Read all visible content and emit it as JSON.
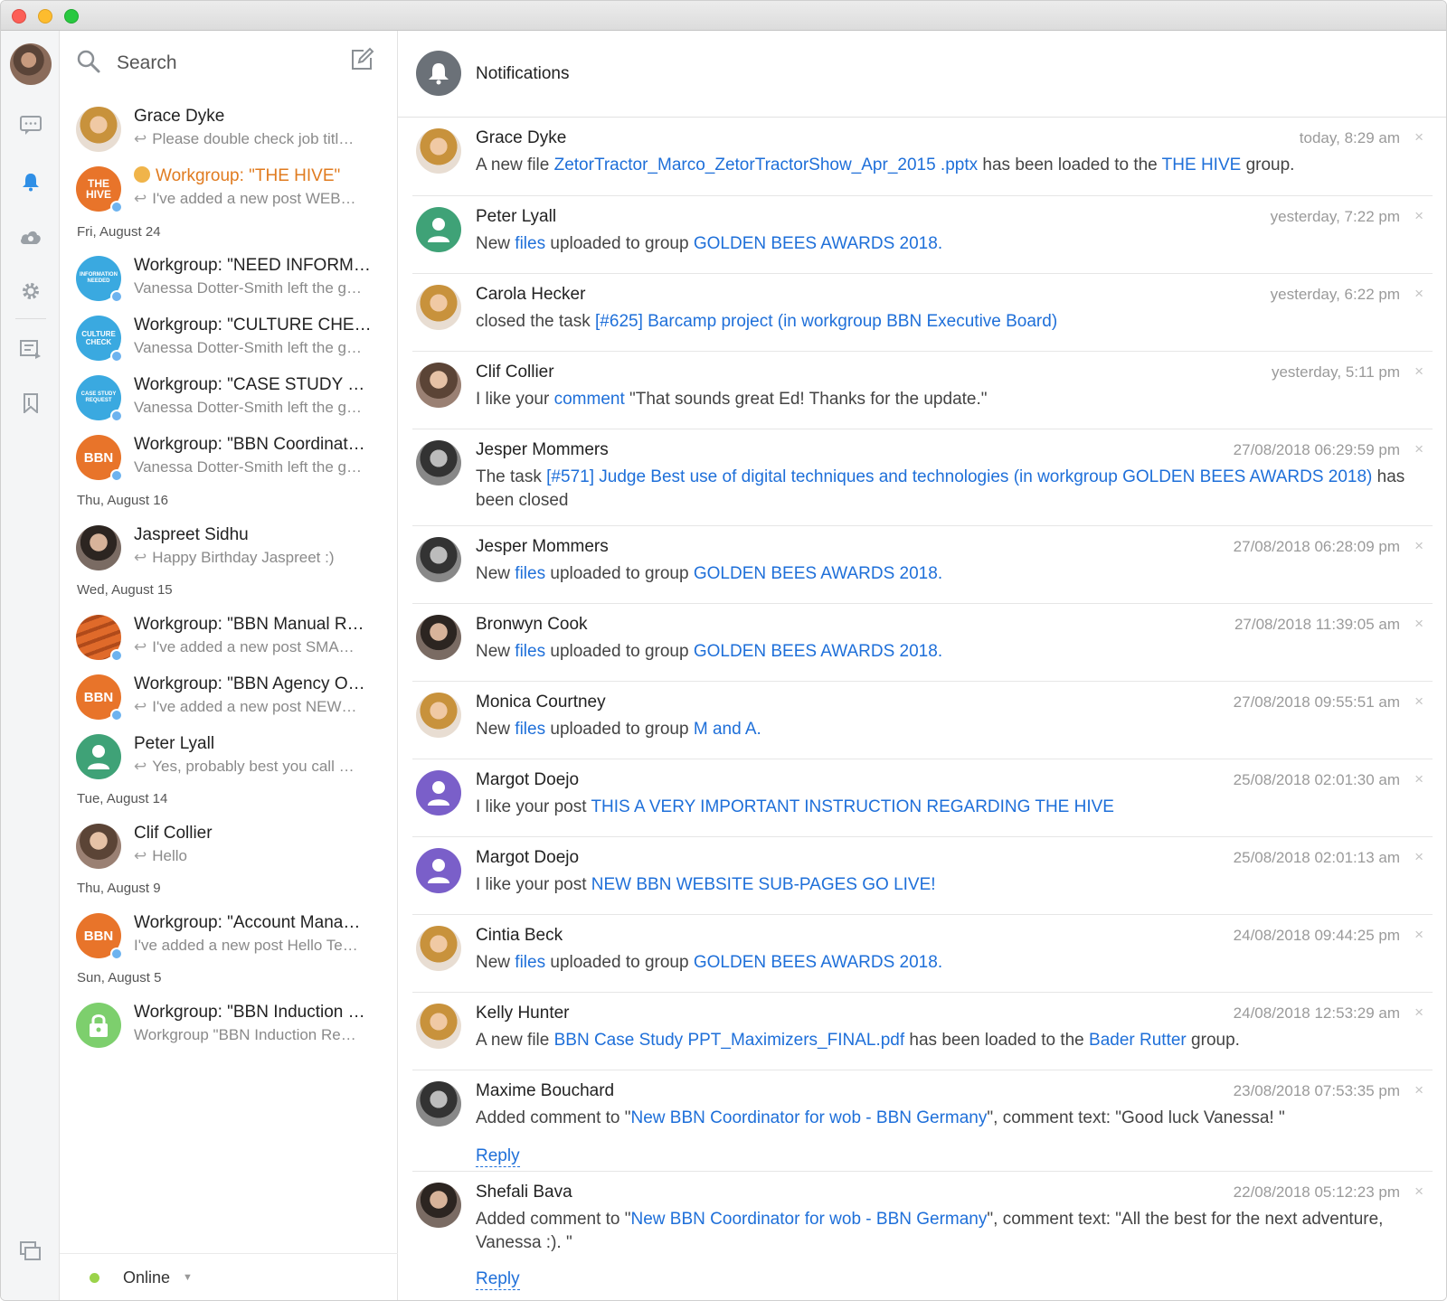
{
  "search": {
    "label": "Search"
  },
  "notifications_header": {
    "title": "Notifications"
  },
  "chats": [
    {
      "name": "Grace Dyke",
      "preview": "Please double check job titl…",
      "reply": true
    },
    {
      "name": "Workgroup: \"THE HIVE\"",
      "preview": "I've added a new post WEB…",
      "reply": true,
      "badge": "THE HIVE",
      "color": "#e8742a"
    },
    {
      "name": "Workgroup: \"NEED INFORM…",
      "preview": "Vanessa Dotter-Smith left the g…",
      "badge": "INFORMATION NEEDED",
      "color": "#3aa9e0"
    },
    {
      "name": "Workgroup: \"CULTURE CHE…",
      "preview": "Vanessa Dotter-Smith left the g…",
      "badge": "CULTURE CHECK",
      "color": "#3aa9e0"
    },
    {
      "name": "Workgroup: \"CASE STUDY …",
      "preview": "Vanessa Dotter-Smith left the g…",
      "badge": "CASE STUDY REQUEST",
      "color": "#3aa9e0"
    },
    {
      "name": "Workgroup: \"BBN Coordinat…",
      "preview": "Vanessa Dotter-Smith left the g…",
      "badge": "BBN",
      "color": "#e8742a"
    },
    {
      "name": "Jaspreet Sidhu",
      "preview": "Happy Birthday Jaspreet :)",
      "reply": true
    },
    {
      "name": "Workgroup: \"BBN Manual R…",
      "preview": "I've added a new post SMA…",
      "reply": true,
      "color": "#e8742a"
    },
    {
      "name": "Workgroup: \"BBN Agency O…",
      "preview": "I've added a new post NEW…",
      "reply": true,
      "badge": "BBN",
      "color": "#e8742a"
    },
    {
      "name": "Peter Lyall",
      "preview": "Yes, probably best you call …",
      "reply": true
    },
    {
      "name": "Clif Collier",
      "preview": "Hello",
      "reply": true
    },
    {
      "name": "Workgroup: \"Account Mana…",
      "preview": "I've added a new post Hello Te…",
      "badge": "BBN",
      "color": "#e8742a"
    },
    {
      "name": "Workgroup: \"BBN Induction …",
      "preview": "Workgroup \"BBN Induction Re…",
      "color": "#7dcf6d"
    }
  ],
  "date_headers": [
    "Fri, August 24",
    "Thu, August 16",
    "Wed, August 15",
    "Tue, August 14",
    "Thu, August 9",
    "Sun, August 5"
  ],
  "status": {
    "label": "Online"
  },
  "notifications": [
    {
      "who": "Grace Dyke",
      "time": "today, 8:29 am",
      "parts": [
        "A new file ",
        "ZetorTractor_Marco_ZetorTractorShow_Apr_2015 .pptx",
        " has been loaded to the ",
        "THE HIVE",
        " group."
      ]
    },
    {
      "who": "Peter Lyall",
      "time": "yesterday, 7:22 pm",
      "parts": [
        "New ",
        "files",
        " uploaded to group ",
        "GOLDEN BEES AWARDS 2018.",
        ""
      ]
    },
    {
      "who": "Carola Hecker",
      "time": "yesterday, 6:22 pm",
      "parts": [
        "closed the task ",
        "[#625] Barcamp project (in workgroup BBN Executive Board)",
        "",
        "",
        ""
      ]
    },
    {
      "who": "Clif Collier",
      "time": "yesterday, 5:11 pm",
      "parts": [
        "I like your ",
        "comment",
        " \"That sounds great Ed! Thanks for the update.\"",
        "",
        ""
      ]
    },
    {
      "who": "Jesper Mommers",
      "time": "27/08/2018 06:29:59 pm",
      "parts": [
        "The task ",
        "[#571] Judge Best use of digital techniques and technologies (in workgroup GOLDEN BEES AWARDS 2018)",
        " has been closed",
        "",
        ""
      ]
    },
    {
      "who": "Jesper Mommers",
      "time": "27/08/2018 06:28:09 pm",
      "parts": [
        "New ",
        "files",
        " uploaded to group ",
        "GOLDEN BEES AWARDS 2018.",
        ""
      ]
    },
    {
      "who": "Bronwyn Cook",
      "time": "27/08/2018 11:39:05 am",
      "parts": [
        "New ",
        "files",
        " uploaded to group ",
        "GOLDEN BEES AWARDS 2018.",
        ""
      ]
    },
    {
      "who": "Monica Courtney",
      "time": "27/08/2018 09:55:51 am",
      "parts": [
        "New ",
        "files",
        " uploaded to group ",
        "M and A.",
        ""
      ]
    },
    {
      "who": "Margot Doejo",
      "time": "25/08/2018 02:01:30 am",
      "parts": [
        "I like your post ",
        "THIS A VERY IMPORTANT INSTRUCTION REGARDING THE HIVE",
        "",
        "",
        ""
      ]
    },
    {
      "who": "Margot Doejo",
      "time": "25/08/2018 02:01:13 am",
      "parts": [
        "I like your post ",
        "NEW BBN WEBSITE SUB-PAGES GO LIVE!",
        "",
        "",
        ""
      ]
    },
    {
      "who": "Cintia Beck",
      "time": "24/08/2018 09:44:25 pm",
      "parts": [
        "New ",
        "files",
        " uploaded to group ",
        "GOLDEN BEES AWARDS 2018.",
        ""
      ]
    },
    {
      "who": "Kelly Hunter",
      "time": "24/08/2018 12:53:29 am",
      "parts": [
        "A new file ",
        "BBN Case Study PPT_Maximizers_FINAL.pdf",
        " has been loaded to the ",
        "Bader Rutter",
        " group."
      ]
    },
    {
      "who": "Maxime Bouchard",
      "time": "23/08/2018 07:53:35 pm",
      "parts": [
        "Added comment to \"",
        "New BBN Coordinator for wob - BBN Germany",
        "\", comment text: \"Good luck Vanessa! \"",
        "",
        ""
      ],
      "reply": "Reply"
    },
    {
      "who": "Shefali Bava",
      "time": "22/08/2018 05:12:23 pm",
      "parts": [
        "Added comment to \"",
        "New BBN Coordinator for wob - BBN Germany",
        "\", comment text: \"All the best for the next adventure, Vanessa :). \"",
        "",
        ""
      ],
      "reply": "Reply"
    }
  ],
  "close_glyph": "×"
}
